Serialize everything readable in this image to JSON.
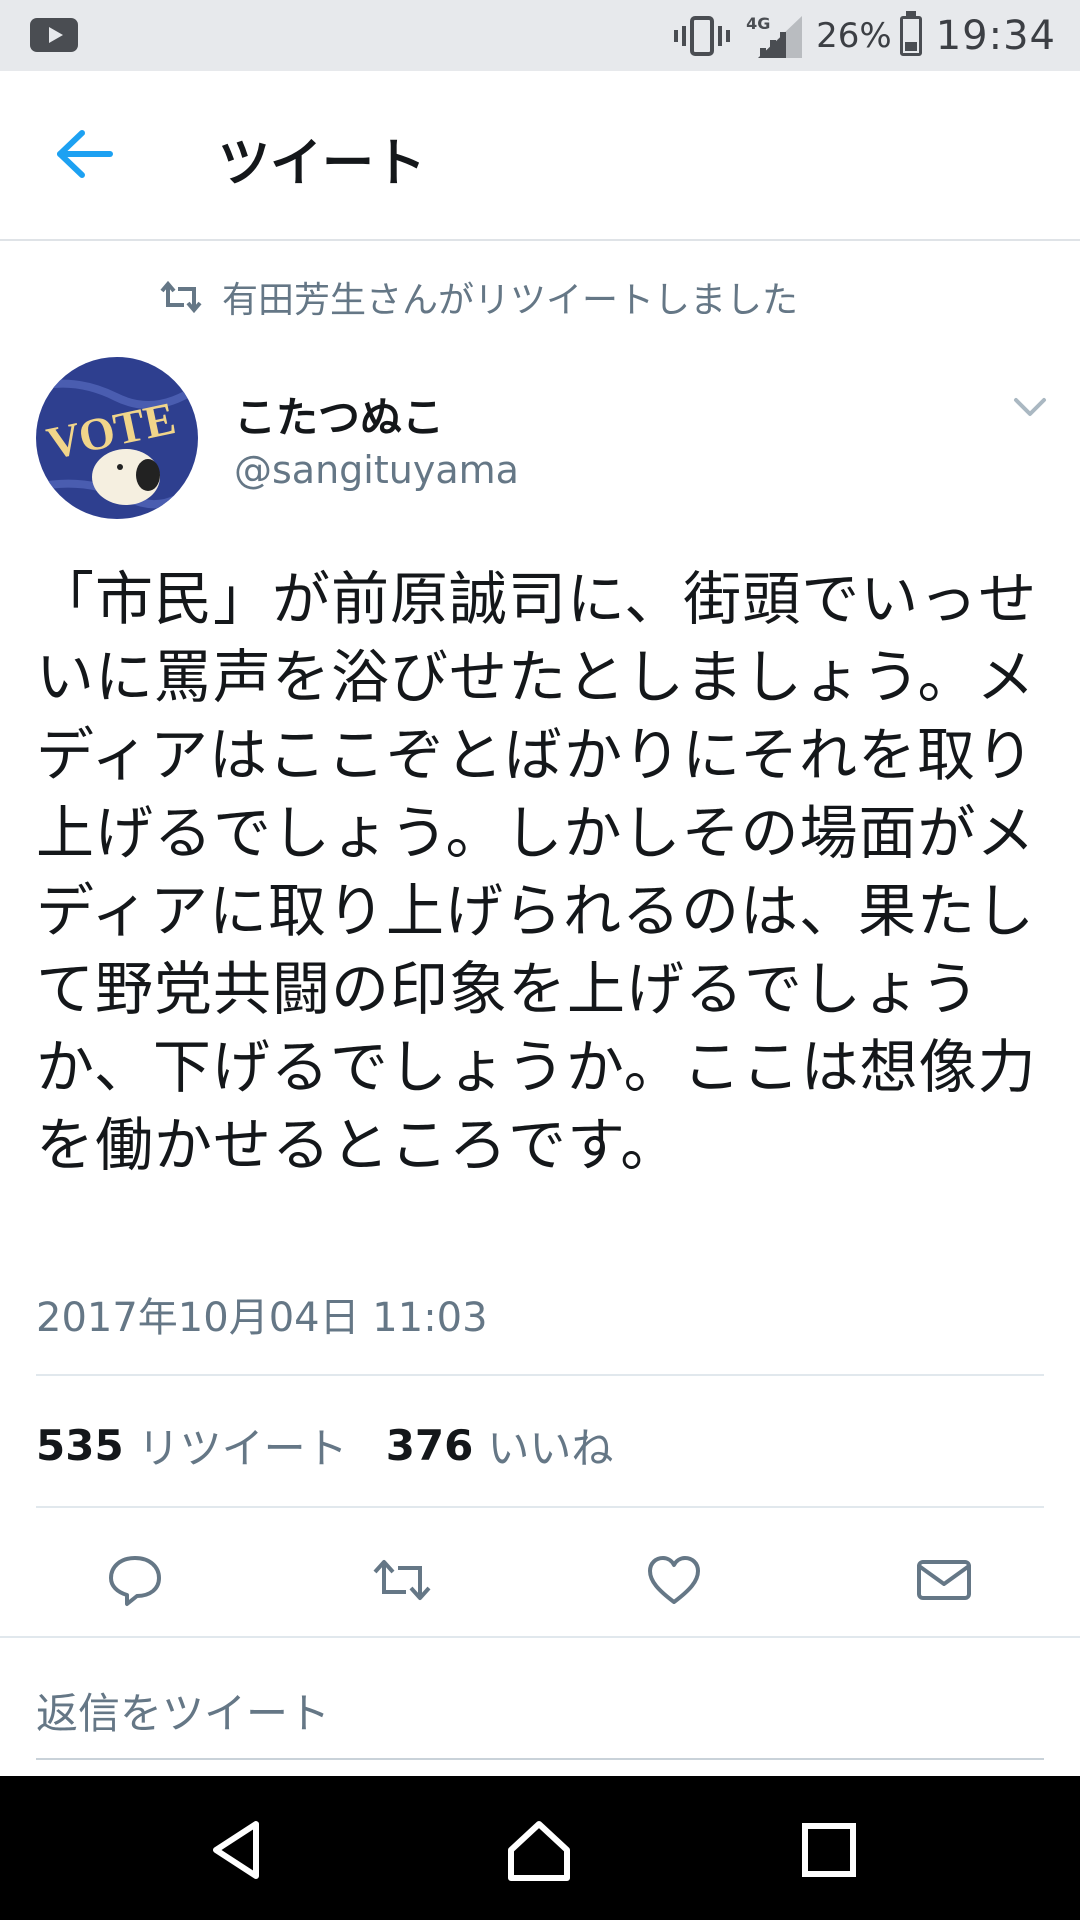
{
  "status_bar": {
    "network": "4G",
    "battery_percent": "26%",
    "time": "19:34",
    "battery_level": 0.26
  },
  "header": {
    "title": "ツイート"
  },
  "retweet_notice": "有田芳生さんがリツイートしました",
  "author": {
    "name": "こたつぬこ",
    "handle": "@sangituyama",
    "avatar_text": "VOTE"
  },
  "tweet": {
    "text": "「市民」が前原誠司に、街頭でいっせいに罵声を浴びせたとしましょう。メディアはここぞとばかりにそれを取り上げるでしょう。しかしその場面がメディアに取り上げられるのは、果たして野党共闘の印象を上げるでしょうか、下げるでしょうか。ここは想像力を働かせるところです。",
    "timestamp": "2017年10月04日 11:03"
  },
  "stats": {
    "retweets_count": "535",
    "retweets_label": "リツイート",
    "likes_count": "376",
    "likes_label": "いいね"
  },
  "actions": [
    "reply-icon",
    "retweet-icon",
    "heart-icon",
    "mail-icon"
  ],
  "reply_field": {
    "placeholder": "返信をツイート"
  },
  "colors": {
    "accent": "#1da1f2",
    "secondary_text": "#657786",
    "primary_text": "#14171a"
  }
}
